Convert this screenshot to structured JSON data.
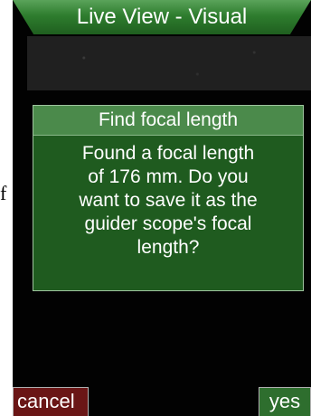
{
  "window": {
    "title": "Live View - Visual"
  },
  "dialog": {
    "title": "Find focal length",
    "message": "Found a focal length\nof 176 mm. Do you\nwant to save it as the\nguider scope's focal\nlength?"
  },
  "buttons": {
    "cancel_label": "cancel",
    "yes_label": "yes"
  },
  "edge_text": "f",
  "colors": {
    "title_bar": "#2e7d2e",
    "dialog_background": "#1f5b1f",
    "dialog_header": "#4b8a4b",
    "cancel_button": "#6a1616",
    "yes_button": "#2e6e2e",
    "screen_background": "#020202"
  }
}
